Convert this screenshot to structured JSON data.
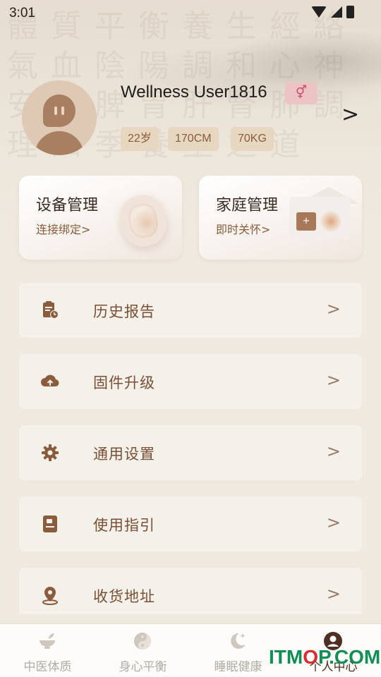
{
  "status_bar": {
    "time": "3:01"
  },
  "profile": {
    "username": "Wellness User1816",
    "gender_symbol": "⚥",
    "tags": [
      "22岁",
      "170CM",
      "70KG"
    ]
  },
  "cards": [
    {
      "title": "设备管理",
      "subtitle": "连接绑定>"
    },
    {
      "title": "家庭管理",
      "subtitle": "即时关怀>",
      "box_glyph": "+"
    }
  ],
  "menu": [
    {
      "label": "历史报告",
      "icon": "history-report-icon"
    },
    {
      "label": "固件升级",
      "icon": "cloud-upload-icon"
    },
    {
      "label": "通用设置",
      "icon": "gear-icon"
    },
    {
      "label": "使用指引",
      "icon": "guide-book-icon"
    },
    {
      "label": "收货地址",
      "icon": "location-pin-icon"
    }
  ],
  "menu_arrow": ">",
  "profile_arrow": ">",
  "bottom_nav": [
    {
      "label": "中医体质",
      "icon": "bowl-icon",
      "active": false
    },
    {
      "label": "身心平衡",
      "icon": "yin-yang-icon",
      "active": false
    },
    {
      "label": "睡眠健康",
      "icon": "moon-star-icon",
      "active": false
    },
    {
      "label": "个人中心",
      "icon": "user-circle-icon",
      "active": true
    }
  ],
  "watermark": {
    "text_a": "ITM",
    "text_b": "O",
    "text_c": "P.COM"
  },
  "colors": {
    "accent": "#8a5c3c",
    "menu_bg": "#f4f0ea",
    "badge_pink": "#ecc4c6",
    "watermark_green": "#0f8f54"
  }
}
